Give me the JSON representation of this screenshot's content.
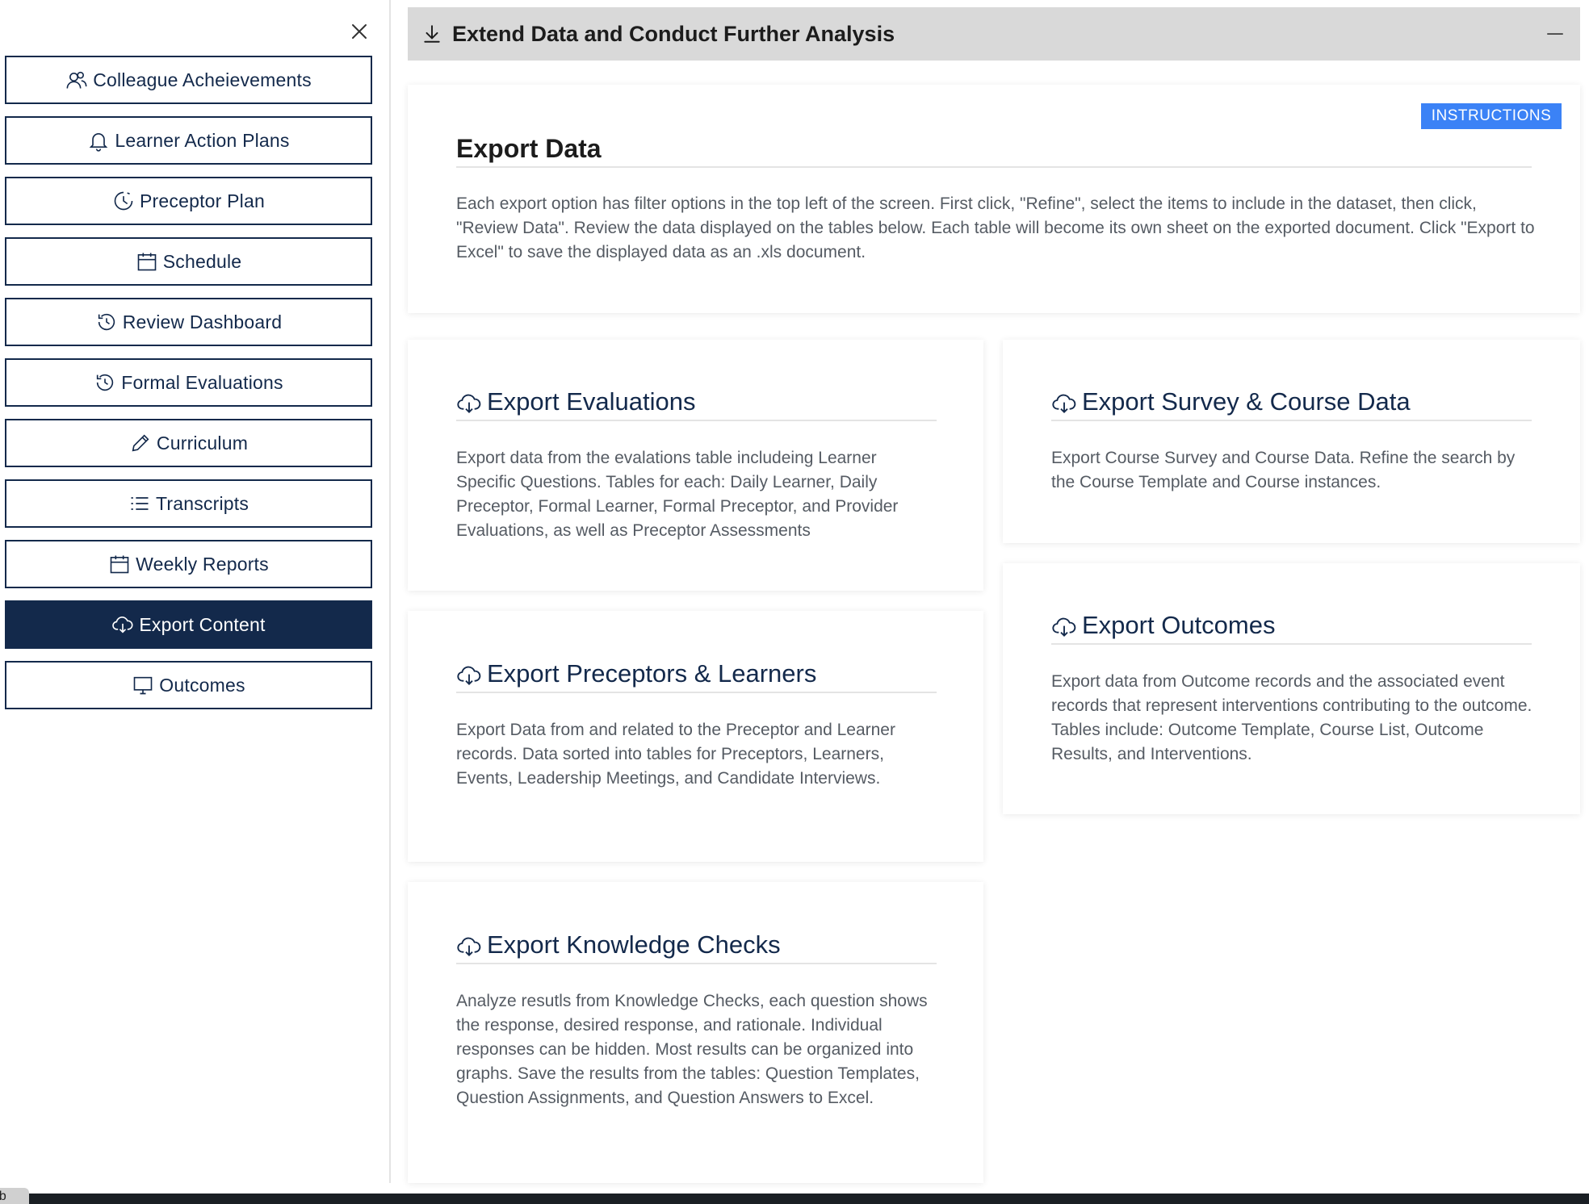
{
  "sidebar": {
    "items": [
      {
        "label": "Colleague Acheievements",
        "icon": "users-icon"
      },
      {
        "label": "Learner Action Plans",
        "icon": "bell-icon"
      },
      {
        "label": "Preceptor Plan",
        "icon": "clock-icon"
      },
      {
        "label": "Schedule",
        "icon": "calendar-icon"
      },
      {
        "label": "Review Dashboard",
        "icon": "history-icon"
      },
      {
        "label": "Formal Evaluations",
        "icon": "history-icon"
      },
      {
        "label": "Curriculum",
        "icon": "pencil-icon"
      },
      {
        "label": "Transcripts",
        "icon": "list-icon"
      },
      {
        "label": "Weekly Reports",
        "icon": "calendar-icon"
      },
      {
        "label": "Export Content",
        "icon": "cloud-download-icon",
        "active": true
      },
      {
        "label": "Outcomes",
        "icon": "monitor-icon"
      }
    ]
  },
  "header": {
    "title": "Extend Data and Conduct Further Analysis"
  },
  "export_data": {
    "title": "Export Data",
    "instructions_label": "INSTRUCTIONS",
    "description": "Each export option has filter options in the top left of the screen. First click, \"Refine\", select the items to include in the dataset, then click, \"Review Data\". Review the data displayed on the tables below. Each table will become its own sheet on the exported document. Click \"Export to Excel\" to save the displayed data as an .xls document."
  },
  "cards": {
    "evaluations": {
      "title": "Export Evaluations",
      "description": "Export data from the evalations table includeing Learner Specific Questions. Tables for each: Daily Learner, Daily Preceptor, Formal Learner, Formal Preceptor, and Provider Evaluations, as well as Preceptor Assessments"
    },
    "survey": {
      "title": "Export Survey & Course Data",
      "description": "Export Course Survey and Course Data. Refine the search by the Course Template and Course instances."
    },
    "preceptors": {
      "title": "Export Preceptors & Learners",
      "description": "Export Data from and related to the Preceptor and Learner records. Data sorted into tables for Preceptors, Learners, Events, Leadership Meetings, and Candidate Interviews."
    },
    "outcomes": {
      "title": "Export Outcomes",
      "description": "Export data from Outcome records and the associated event records that represent interventions contributing to the outcome. Tables include: Outcome Template, Course List, Outcome Results, and Interventions."
    },
    "knowledge": {
      "title": "Export Knowledge Checks",
      "description": "Analyze resutls from Knowledge Checks, each question shows the response, desired response, and rationale. Individual responses can be hidden. Most results can be organized into graphs. Save the results from the tables: Question Templates, Question Assignments, and Question Answers to Excel."
    }
  },
  "footer": {
    "tab_label": "ab"
  },
  "colors": {
    "navy": "#13294b",
    "accent_blue": "#3b82f6",
    "header_gray": "#d9d9d9"
  }
}
